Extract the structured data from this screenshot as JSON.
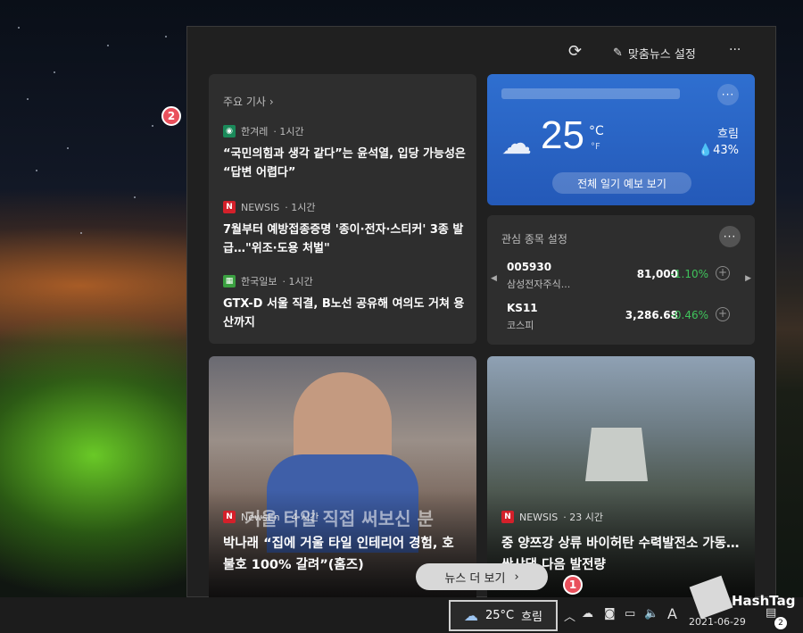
{
  "panel": {
    "refresh_icon": "refresh-icon",
    "personalize_label": "맞춤뉴스 설정",
    "more_label": "···"
  },
  "top_stories": {
    "header": "주요 기사",
    "articles": [
      {
        "source": "한겨레",
        "time": "· 1시간",
        "title": "“국민의힘과 생각 같다”는 윤석열, 입당 가능성은 “답변 어렵다”"
      },
      {
        "source": "NEWSIS",
        "time": "· 1시간",
        "title": "7월부터 예방접종증명 '종이·전자·스티커' 3종 발급…\"위조·도용 처벌\""
      },
      {
        "source": "한국일보",
        "time": "· 1시간",
        "title": "GTX-D 서울 직결, B노선 공유해 여의도 거쳐 용산까지"
      }
    ]
  },
  "weather": {
    "temp": "25",
    "unit_c": "°C",
    "unit_f": "°F",
    "condition": "흐림",
    "humidity": "43%",
    "forecast_button": "전체 일기 예보 보기"
  },
  "stocks": {
    "header": "관심 종목 설정",
    "rows": [
      {
        "symbol": "005930",
        "name": "삼성전자주식...",
        "price": "81,000",
        "change": "-1.10%"
      },
      {
        "symbol": "KS11",
        "name": "코스피",
        "price": "3,286.68",
        "change": "-0.46%"
      }
    ],
    "change_color": "#3fc35b"
  },
  "image_cards": [
    {
      "source": "NewsEn",
      "time": "· 4 시간",
      "title": "박나래 “집에 거울 타일 인테리어 경험, 호불호 100% 갈려”(홈즈)",
      "overlay": "거울 타일 직접 써보신 분"
    },
    {
      "source": "NEWSIS",
      "time": "· 23 시간",
      "title": "중 양쯔강 상류 바이허탄 수력발전소 가동…싼샤댐 다음 발전량"
    }
  ],
  "see_more_news": "뉴스 더 보기",
  "taskbar": {
    "weather_temp": "25°C",
    "weather_condition": "흐림",
    "ime": "A",
    "date": "2021-06-29",
    "notification_count": "2"
  },
  "callouts": [
    "1",
    "2"
  ],
  "watermark": "HashTag"
}
